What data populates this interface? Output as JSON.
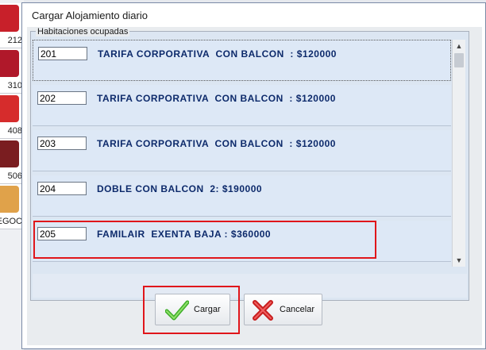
{
  "dialog": {
    "title": "Cargar Alojamiento diario",
    "group_label": "Habitaciones ocupadas",
    "rooms": [
      {
        "number": "201",
        "description": "TARIFA CORPORATIVA  CON BALCON  : $120000"
      },
      {
        "number": "202",
        "description": "TARIFA CORPORATIVA  CON BALCON  : $120000"
      },
      {
        "number": "203",
        "description": "TARIFA CORPORATIVA  CON BALCON  : $120000"
      },
      {
        "number": "204",
        "description": "DOBLE CON BALCON  2: $190000"
      },
      {
        "number": "205",
        "description": "FAMILAIR  EXENTA BAJA : $360000"
      }
    ],
    "buttons": {
      "load_label": "Cargar",
      "cancel_label": "Cancelar"
    }
  },
  "background": {
    "tiles": [
      "212",
      "310",
      "408",
      "506",
      "IEGOC"
    ]
  },
  "colors": {
    "highlight": "#e0161b",
    "room_text": "#0d2a6b",
    "panel": "#dce6f2"
  }
}
